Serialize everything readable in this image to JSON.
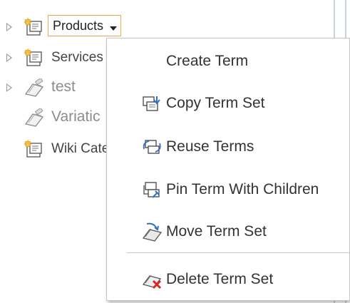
{
  "tree": {
    "nodes": [
      {
        "label": "Products",
        "expander": true,
        "selected": true
      },
      {
        "label": "Services",
        "expander": true
      },
      {
        "label": "test",
        "expander": true,
        "disabled": true
      },
      {
        "label": "Variatic",
        "expander": false,
        "disabled": true
      },
      {
        "label": "Wiki Cate",
        "expander": false
      }
    ]
  },
  "context_menu": {
    "items": [
      {
        "label": "Create Term",
        "icon": "none"
      },
      {
        "label": "Copy Term Set",
        "icon": "copy-term-set-icon"
      },
      {
        "label": "Reuse Terms",
        "icon": "reuse-terms-icon"
      },
      {
        "label": "Pin Term With Children",
        "icon": "pin-term-icon"
      },
      {
        "label": "Move Term Set",
        "icon": "move-term-set-icon"
      },
      {
        "label": "Delete Term Set",
        "icon": "delete-term-set-icon"
      }
    ]
  },
  "colors": {
    "selected_border": "#f1a650",
    "menu_border": "#c7c7c7",
    "delete_red": "#d9261c",
    "icon_blue": "#2f6fc6"
  }
}
